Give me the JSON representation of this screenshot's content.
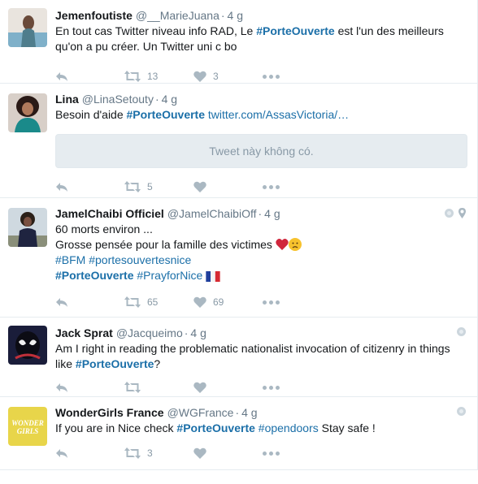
{
  "tweets": [
    {
      "fullname": "Jemenfoutiste",
      "username": "@__MarieJuana",
      "time": "4 g",
      "text_parts": [
        "En tout cas Twitter niveau info RAD, Le ",
        "#PorteOuverte",
        " est l'un des meilleurs qu'on a pu créer. Un Twitter uni c bo"
      ],
      "retweets": "13",
      "likes": "3"
    },
    {
      "fullname": "Lina",
      "username": "@LinaSetouty",
      "time": "4 g",
      "text_parts": [
        "Besoin d'aide ",
        "#PorteOuverte",
        " ",
        "twitter.com/AssasVictoria/…"
      ],
      "withheld": "Tweet này không có.",
      "retweets": "5",
      "likes": ""
    },
    {
      "fullname": "JamelChaibi Officiel",
      "username": "@JamelChaibiOff",
      "time": "4 g",
      "line1": "60 morts environ  ...",
      "line2": "Grosse pensée pour la famille des victimes",
      "line3_tags": [
        "#BFM",
        "#portesouvertesnice"
      ],
      "line4_tags": [
        "#PorteOuverte",
        "#PrayforNice"
      ],
      "retweets": "65",
      "likes": "69"
    },
    {
      "fullname": "Jack Sprat",
      "username": "@Jacqueimo",
      "time": "4 g",
      "text_parts": [
        "Am I right in reading the problematic nationalist invocation of citizenry in things like ",
        "#PorteOuverte",
        "?"
      ],
      "retweets": "",
      "likes": ""
    },
    {
      "fullname": "WonderGirls France",
      "username": "@WGFrance",
      "time": "4 g",
      "text_parts": [
        "If you are in Nice check ",
        "#PorteOuverte",
        " ",
        "#opendoors",
        " Stay safe !"
      ],
      "avatar_text": "WONDER GIRLS",
      "retweets": "3",
      "likes": ""
    }
  ],
  "colors": {
    "link": "#1b6fa8",
    "icon": "#aab8c2",
    "border": "#e6ecf0"
  }
}
